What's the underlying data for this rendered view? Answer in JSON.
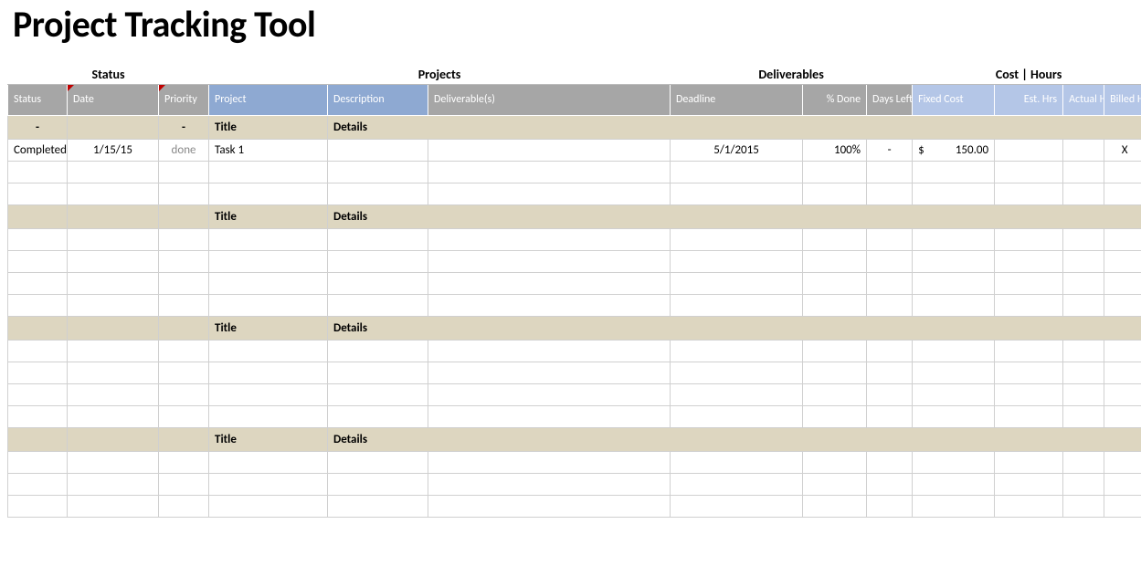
{
  "title": "Project Tracking Tool",
  "groupHeaders": {
    "status": "Status",
    "projects": "Projects",
    "deliverables": "Deliverables",
    "costHours": "Cost | Hours"
  },
  "columns": {
    "status": "Status",
    "date": "Date",
    "priority": "Priority",
    "project": "Project",
    "description": "Description",
    "deliverables": "Deliverable(s)",
    "deadline": "Deadline",
    "pctDone": "% Done",
    "daysLeft": "Days Left",
    "fixedCost": "Fixed Cost",
    "estHrs": "Est. Hrs",
    "actualHrs": "Actual Hrs",
    "billedHrs": "Billed Hrs"
  },
  "sectionLabels": {
    "status": "-",
    "priority": "-",
    "project": "Title",
    "description": "Details"
  },
  "rows": [
    {
      "status": "Completed",
      "date": "1/15/15",
      "priority": "done",
      "project": "Task 1",
      "description": "",
      "deliverables": "",
      "deadline": "5/1/2015",
      "pctDone": "100%",
      "daysLeft": "-",
      "fixedCurrency": "$",
      "fixedCost": "150.00",
      "estHrs": "",
      "actualHrs": "",
      "billedHrs": "X"
    }
  ]
}
